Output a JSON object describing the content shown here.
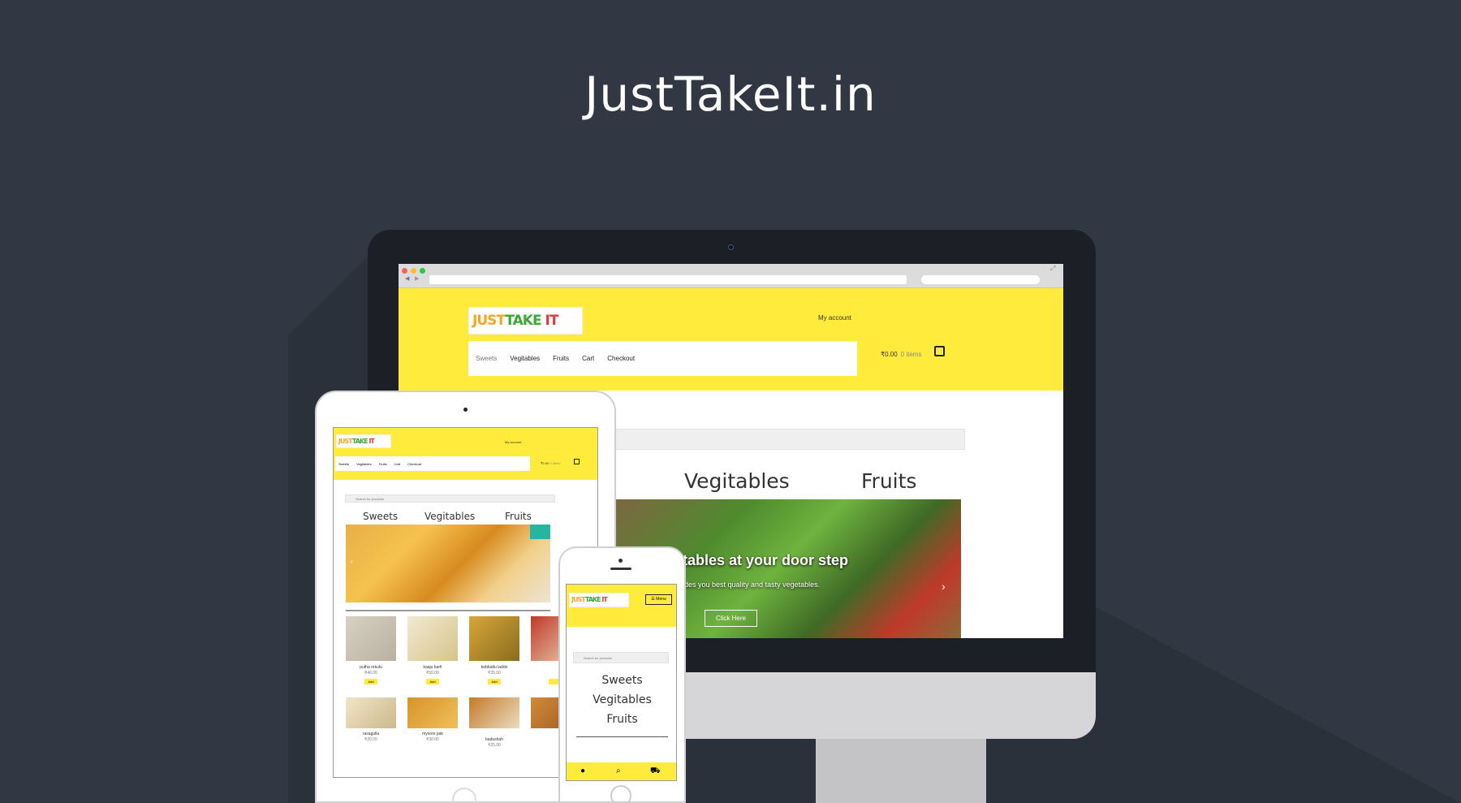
{
  "page": {
    "title": "JustTakeIt.in"
  },
  "brand": {
    "logo_part1": "JUST",
    "logo_part2": "TAKE",
    "logo_part3": "IT"
  },
  "colors": {
    "accent_yellow": "#ffeb3b",
    "background": "#323843",
    "slide_teal": "#26b5a0"
  },
  "desktop": {
    "my_account": "My account",
    "nav": [
      "Sweets",
      "Vegitables",
      "Fruits",
      "Cart",
      "Checkout"
    ],
    "cart_total": "₹0.00",
    "cart_items": "0 items",
    "categories": [
      "Vegitables",
      "Fruits"
    ],
    "slide_heading": "tables at your door step",
    "slide_subtext": "ides you best quality and tasty vegetables.",
    "slide_button": "Click Here",
    "icons": [
      "back-arrow-icon",
      "forward-arrow-icon",
      "search-icon",
      "expand-icon",
      "shopping-bag-icon",
      "chevron-right-icon",
      "apple-logo-icon"
    ]
  },
  "tablet": {
    "my_account": "My account",
    "nav": [
      "Sweets",
      "Vegitables",
      "Fruits",
      "Cart",
      "Checkout"
    ],
    "cart_total": "₹0.00",
    "cart_items": "0 items",
    "search_placeholder": "Search for products",
    "categories": [
      "Sweets",
      "Vegitables",
      "Fruits"
    ],
    "products": [
      {
        "name": "putha rekulu",
        "price": "₹40.00",
        "add": "Add"
      },
      {
        "name": "kaaju barfi",
        "price": "₹50.00",
        "add": "Add"
      },
      {
        "name": "bobbatlu laddo",
        "price": "₹35.00",
        "add": "Add"
      },
      {
        "name": "rasagulla",
        "price": "₹20.00",
        "add": ""
      },
      {
        "name": "mysore pak",
        "price": "₹30.00",
        "add": ""
      },
      {
        "name": "badushah",
        "price": "₹25.00",
        "add": ""
      }
    ]
  },
  "phone": {
    "menu_label": "Menu",
    "search_placeholder": "Search for products",
    "categories": [
      "Sweets",
      "Vegitables",
      "Fruits"
    ],
    "icons": [
      "user-icon",
      "search-icon",
      "cart-icon"
    ]
  }
}
